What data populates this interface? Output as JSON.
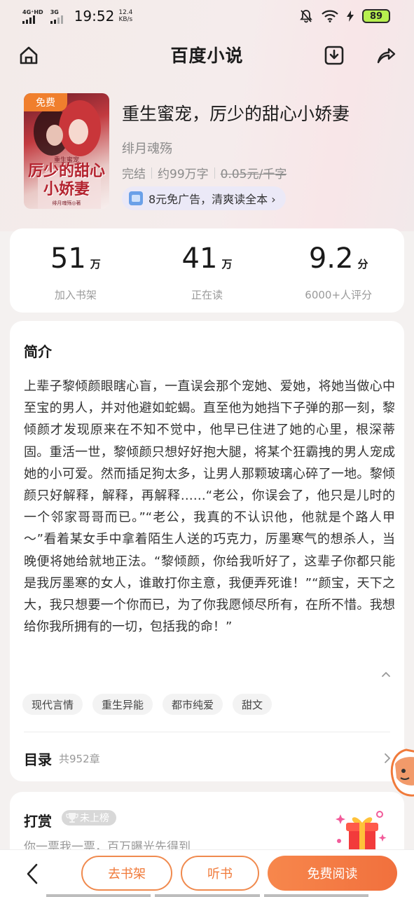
{
  "status_bar": {
    "network_1": "4G⁺HD",
    "network_2": "3G",
    "time": "19:52",
    "speed_value": "12.4",
    "speed_unit": "KB/s",
    "battery": "89"
  },
  "nav": {
    "title": "百度小说",
    "icons": [
      "home-icon",
      "download-icon",
      "share-icon"
    ]
  },
  "book": {
    "cover_badge": "免费",
    "cover_subtitle": "重生蜜宠",
    "cover_title": "厉少的甜心小娇妻",
    "cover_author": "绯月魂殇◎著",
    "title": "重生蜜宠，厉少的甜心小娇妻",
    "author": "绯月魂殇",
    "status": "完结",
    "word_count": "约99万字",
    "price": "0.05元/千字",
    "promo": "8元免广告，清爽读全本 ›"
  },
  "stats": [
    {
      "value": "51",
      "unit": "万",
      "label": "加入书架"
    },
    {
      "value": "41",
      "unit": "万",
      "label": "正在读"
    },
    {
      "value": "9.2",
      "unit": "分",
      "label": "6000+人评分"
    }
  ],
  "intro": {
    "title": "简介",
    "text": "上辈子黎倾颜眼瞎心盲，一直误会那个宠她、爱她，将她当做心中至宝的男人，并对他避如蛇蝎。直至他为她挡下子弹的那一刻，黎倾颜才发现原来在不知不觉中，他早已住进了她的心里，根深蒂固。重活一世，黎倾颜只想好好抱大腿，将某个狂霸拽的男人宠成她的小可爱。然而插足狗太多，让男人那颗玻璃心碎了一地。黎倾颜只好解释，解释，再解释……“老公，你误会了，他只是儿时的一个邻家哥哥而已。”“老公，我真的不认识他，他就是个路人甲～”看着某女手中拿着陌生人送的巧克力，厉墨寒气的想杀人，当晚便将她给就地正法。“黎倾颜，你给我听好了，这辈子你都只能是我厉墨寒的女人，谁敢打你主意，我便弄死谁！”“颜宝，天下之大，我只想要一个你而已，为了你我愿倾尽所有，在所不惜。我想给你我所拥有的一切，包括我的命！”",
    "tags": [
      "现代言情",
      "重生异能",
      "都市纯爱",
      "甜文"
    ]
  },
  "toc": {
    "title": "目录",
    "count": "共952章"
  },
  "reward": {
    "title": "打赏",
    "rank": "未上榜",
    "subtitle": "你一票我一票，百万曝光先得到"
  },
  "bottom_bar": {
    "shelf": "去书架",
    "listen": "听书",
    "read": "免费阅读"
  },
  "colors": {
    "accent": "#f07a3a",
    "battery": "#b7ef4f"
  }
}
